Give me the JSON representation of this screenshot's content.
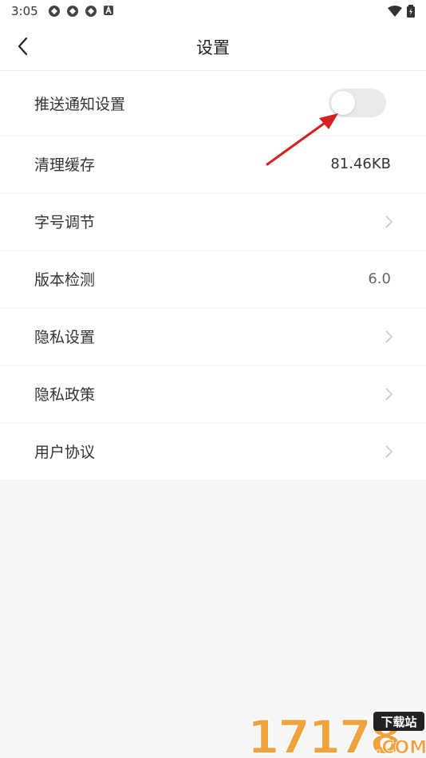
{
  "status_bar": {
    "time": "3:05"
  },
  "header": {
    "title": "设置"
  },
  "settings": {
    "push_label": "推送通知设置",
    "push_enabled": false,
    "cache_label": "清理缓存",
    "cache_value": "81.46KB",
    "font_label": "字号调节",
    "version_label": "版本检测",
    "version_value": "6.0",
    "privacy_settings_label": "隐私设置",
    "privacy_policy_label": "隐私政策",
    "user_agreement_label": "用户协议"
  },
  "watermark": {
    "number": "17178",
    "tag": "下载站",
    "suffix": ".COM"
  },
  "colors": {
    "annotation_arrow": "#d42020",
    "watermark_orange": "#f0a23c",
    "toggle_off": "#e9e9e9"
  }
}
